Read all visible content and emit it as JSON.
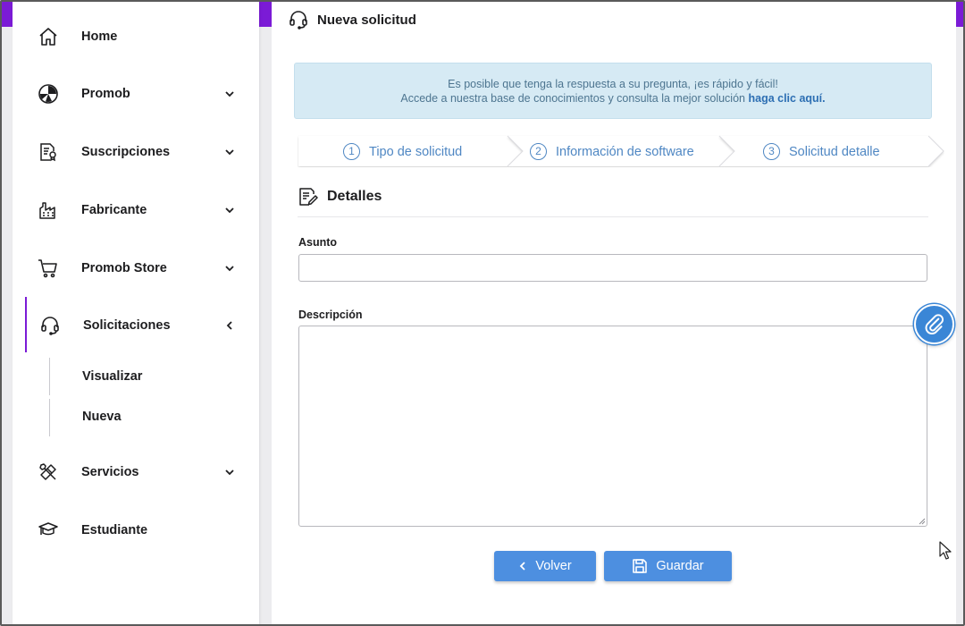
{
  "sidebar": {
    "items": [
      {
        "label": "Home",
        "icon": "home-icon"
      },
      {
        "label": "Promob",
        "icon": "promob-icon"
      },
      {
        "label": "Suscripciones",
        "icon": "subscription-document-icon"
      },
      {
        "label": "Fabricante",
        "icon": "factory-icon"
      },
      {
        "label": "Promob Store",
        "icon": "shopping-cart-icon"
      },
      {
        "label": "Solicitaciones",
        "icon": "headset-icon"
      },
      {
        "label": "Servicios",
        "icon": "tools-icon"
      },
      {
        "label": "Estudiante",
        "icon": "graduation-cap-icon"
      }
    ],
    "sub_items": [
      {
        "label": "Visualizar"
      },
      {
        "label": "Nueva"
      }
    ]
  },
  "header": {
    "title": "Nueva solicitud",
    "icon": "headset-icon"
  },
  "info": {
    "line1": "Es posible que tenga la respuesta a su pregunta, ¡es rápido y fácil!",
    "line2": "Accede a nuestra base de conocimientos y consulta la mejor solución",
    "link": "haga clic aquí."
  },
  "steps": [
    {
      "num": "1",
      "label": "Tipo de solicitud"
    },
    {
      "num": "2",
      "label": "Información de software"
    },
    {
      "num": "3",
      "label": "Solicitud detalle"
    }
  ],
  "section": {
    "title": "Detalles",
    "icon": "edit-document-icon"
  },
  "form": {
    "subject_label": "Asunto",
    "subject_value": "",
    "description_label": "Descripción",
    "description_value": ""
  },
  "buttons": {
    "back": "Volver",
    "save": "Guardar"
  },
  "colors": {
    "accent": "#7b1bd6",
    "primary_button": "#4d8fe0",
    "info_background": "#d6eaf4",
    "step_text": "#4f87c3"
  }
}
